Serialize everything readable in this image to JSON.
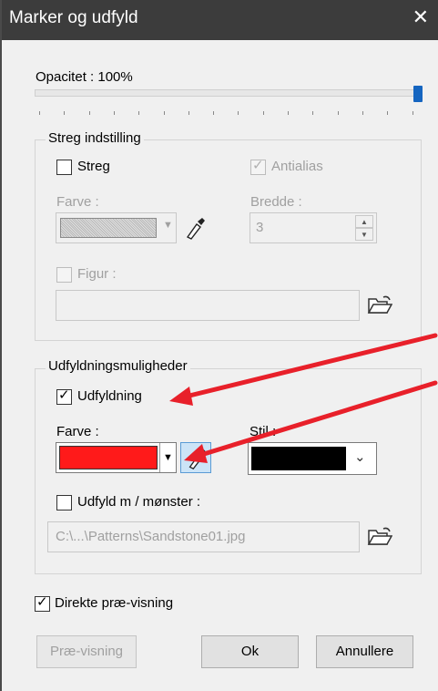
{
  "dialog": {
    "title": "Marker og udfyld",
    "close_glyph": "✕"
  },
  "opacity": {
    "label": "Opacitet : 100%",
    "value_percent": 100
  },
  "stroke": {
    "group_title": "Streg indstilling",
    "streg_label": "Streg",
    "streg_checked": false,
    "antialias_label": "Antialias",
    "antialias_checked": true,
    "farve_label": "Farve :",
    "bredde_label": "Bredde :",
    "bredde_value": "3",
    "figur_label": "Figur :",
    "figur_value": ""
  },
  "fill": {
    "group_title": "Udfyldningsmuligheder",
    "udfyldning_label": "Udfyldning",
    "udfyldning_checked": true,
    "farve_label": "Farve :",
    "farve_color": "#ff1a1a",
    "stil_label": "Stil :",
    "stil_color": "#000000",
    "pattern_label": "Udfyld m / mønster :",
    "pattern_checked": false,
    "pattern_path": "C:\\...\\Patterns\\Sandstone01.jpg"
  },
  "preview": {
    "direkte_label": "Direkte præ-visning",
    "direkte_checked": true
  },
  "buttons": {
    "preview": "Præ-visning",
    "ok": "Ok",
    "cancel": "Annullere"
  },
  "colors": {
    "titlebar": "#3c3c3c",
    "accent": "#1565c0",
    "annotation_arrow": "#e8202a"
  },
  "icons": [
    "close-icon",
    "dropdown-arrow-icon",
    "pipette-icon",
    "folder-open-icon",
    "spinner-up-icon",
    "spinner-down-icon",
    "checkmark-icon"
  ]
}
